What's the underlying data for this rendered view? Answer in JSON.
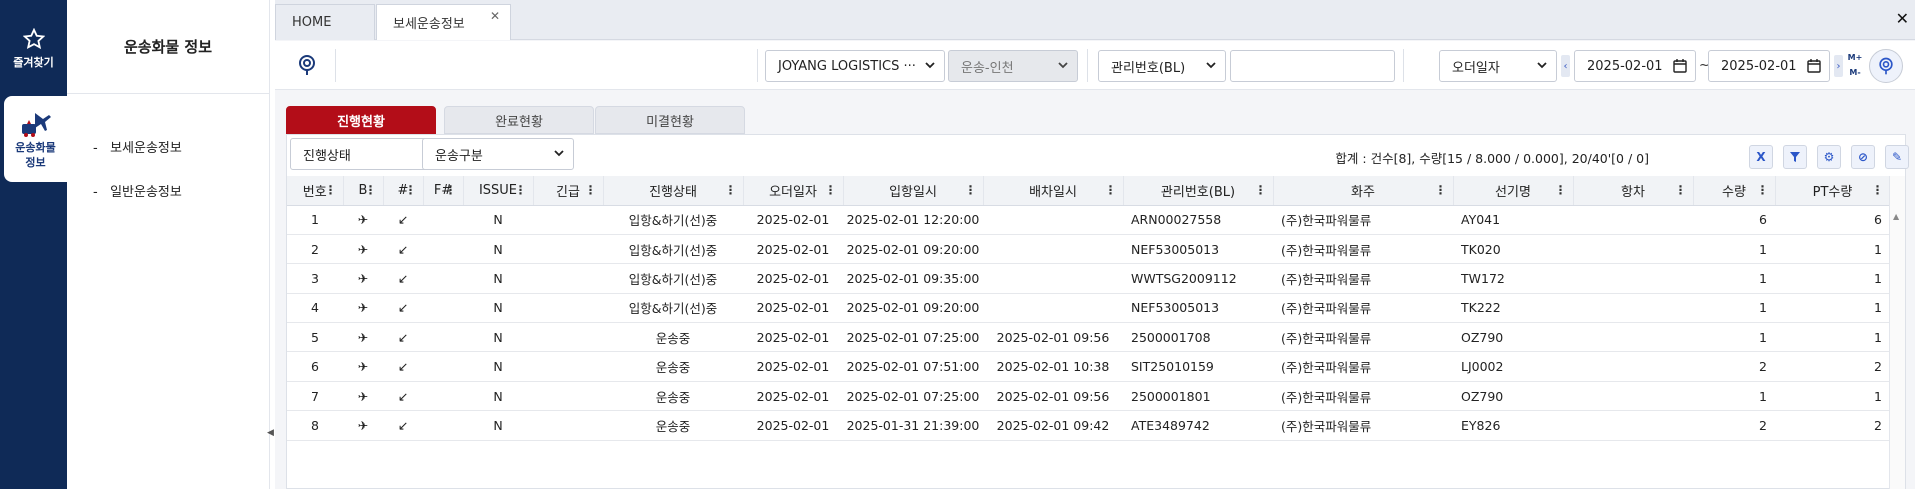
{
  "rail": {
    "favorites_label": "즐겨찾기",
    "cargo_label": "운송화물\n정보"
  },
  "side": {
    "title": "운송화물 정보",
    "items": [
      "보세운송정보",
      "일반운송정보"
    ]
  },
  "tabs": [
    {
      "label": "HOME"
    },
    {
      "label": "보세운송정보"
    }
  ],
  "toolbar": {
    "company": "JOYANG LOGISTICS ···",
    "transport": "운송-인천",
    "key_type": "관리번호(BL)",
    "key_value": "",
    "date_type": "오더일자",
    "date_from": "2025-02-01",
    "date_to": "2025-02-01",
    "tilde": "~",
    "mplus": "M+",
    "mminus": "M-"
  },
  "status_tabs": [
    "진행현황",
    "완료현황",
    "미결현황"
  ],
  "filters": {
    "status": "진행상태",
    "transport_type": "운송구분"
  },
  "summary": "합계 : 건수[8], 수량[15 / 8.000 / 0.000], 20/40'[0 / 0]",
  "action_icons": [
    "excel-x",
    "filter",
    "settings",
    "block",
    "pin"
  ],
  "columns": [
    "번호",
    "B",
    "#",
    "F#",
    "ISSUE",
    "긴급",
    "진행상태",
    "오더일자",
    "입항일시",
    "배차일시",
    "관리번호(BL)",
    "화주",
    "선기명",
    "항차",
    "수량",
    "PT수량"
  ],
  "rows": [
    [
      "1",
      "✈",
      "↙",
      "",
      "N",
      "",
      "입항&하기(선)중",
      "2025-02-01",
      "2025-02-01 12:20:00",
      "",
      "ARN00027558",
      "(주)한국파워물류",
      "AY041",
      "",
      "6",
      "6"
    ],
    [
      "2",
      "✈",
      "↙",
      "",
      "N",
      "",
      "입항&하기(선)중",
      "2025-02-01",
      "2025-02-01 09:20:00",
      "",
      "NEF53005013",
      "(주)한국파워물류",
      "TK020",
      "",
      "1",
      "1"
    ],
    [
      "3",
      "✈",
      "↙",
      "",
      "N",
      "",
      "입항&하기(선)중",
      "2025-02-01",
      "2025-02-01 09:35:00",
      "",
      "WWTSG2009112",
      "(주)한국파워물류",
      "TW172",
      "",
      "1",
      "1"
    ],
    [
      "4",
      "✈",
      "↙",
      "",
      "N",
      "",
      "입항&하기(선)중",
      "2025-02-01",
      "2025-02-01 09:20:00",
      "",
      "NEF53005013",
      "(주)한국파워물류",
      "TK222",
      "",
      "1",
      "1"
    ],
    [
      "5",
      "✈",
      "↙",
      "",
      "N",
      "",
      "운송중",
      "2025-02-01",
      "2025-02-01 07:25:00",
      "2025-02-01 09:56",
      "2500001708",
      "(주)한국파워물류",
      "OZ790",
      "",
      "1",
      "1"
    ],
    [
      "6",
      "✈",
      "↙",
      "",
      "N",
      "",
      "운송중",
      "2025-02-01",
      "2025-02-01 07:51:00",
      "2025-02-01 10:38",
      "SIT25010159",
      "(주)한국파워물류",
      "LJ0002",
      "",
      "2",
      "2"
    ],
    [
      "7",
      "✈",
      "↙",
      "",
      "N",
      "",
      "운송중",
      "2025-02-01",
      "2025-02-01 07:25:00",
      "2025-02-01 09:56",
      "2500001801",
      "(주)한국파워물류",
      "OZ790",
      "",
      "1",
      "1"
    ],
    [
      "8",
      "✈",
      "↙",
      "",
      "N",
      "",
      "운송중",
      "2025-02-01",
      "2025-01-31 21:39:00",
      "2025-02-01 09:42",
      "ATE3489742",
      "(주)한국파워물류",
      "EY826",
      "",
      "2",
      "2"
    ]
  ],
  "colors": {
    "rail": "#0f2a57",
    "active_tab": "#b30d18",
    "accent": "#2b56c8"
  }
}
